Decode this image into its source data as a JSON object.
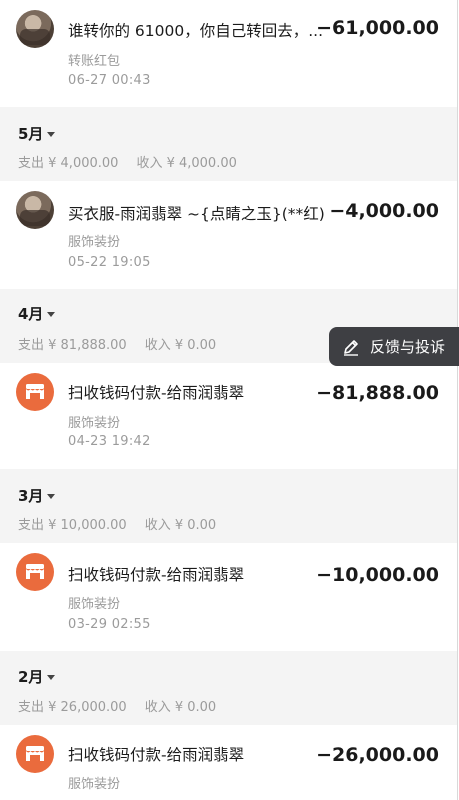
{
  "months": [
    {
      "label": "5月",
      "expense": "支出 ¥ 4,000.00",
      "income": "收入 ¥ 4,000.00"
    },
    {
      "label": "4月",
      "expense": "支出 ¥ 81,888.00",
      "income": "收入 ¥ 0.00"
    },
    {
      "label": "3月",
      "expense": "支出 ¥ 10,000.00",
      "income": "收入 ¥ 0.00"
    },
    {
      "label": "2月",
      "expense": "支出 ¥ 26,000.00",
      "income": "收入 ¥ 0.00"
    }
  ],
  "transactions": [
    {
      "title": "谁转你的 61000，你自己转回去，...",
      "amount": "−61,000.00",
      "category": "转账红包",
      "time": "06-27  00:43",
      "icon": "avatar-photo"
    },
    {
      "title": "买衣服-雨润翡翠 ~{点睛之玉}(**红)",
      "amount": "−4,000.00",
      "category": "服饰装扮",
      "time": "05-22  19:05",
      "icon": "avatar-photo"
    },
    {
      "title": "扫收钱码付款-给雨润翡翠",
      "amount": "−81,888.00",
      "category": "服饰装扮",
      "time": "04-23  19:42",
      "icon": "shop-icon"
    },
    {
      "title": "扫收钱码付款-给雨润翡翠",
      "amount": "−10,000.00",
      "category": "服饰装扮",
      "time": "03-29  02:55",
      "icon": "shop-icon"
    },
    {
      "title": "扫收钱码付款-给雨润翡翠",
      "amount": "−26,000.00",
      "category": "服饰装扮",
      "time": "",
      "icon": "shop-icon"
    }
  ],
  "feedback": {
    "label": "反馈与投诉"
  }
}
